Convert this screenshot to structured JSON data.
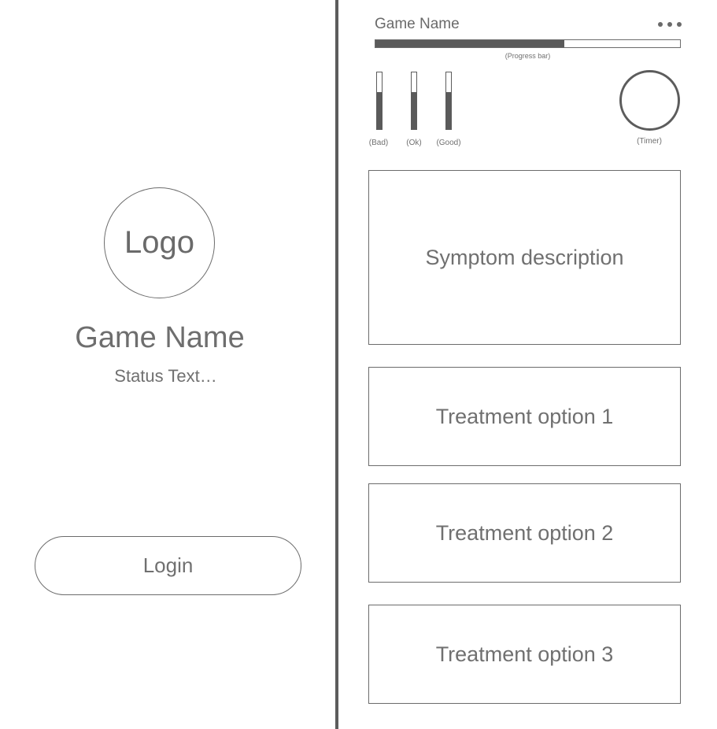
{
  "login_screen": {
    "logo_text": "Logo",
    "game_name": "Game Name",
    "status_text": "Status Text…",
    "login_label": "Login"
  },
  "game_screen": {
    "game_name": "Game Name",
    "menu_icon": "more-horizontal-icon",
    "progress": {
      "label": "(Progress bar)",
      "fraction": 0.62
    },
    "meters": [
      {
        "label": "(Bad)",
        "fraction": 0.65
      },
      {
        "label": "(Ok)",
        "fraction": 0.65
      },
      {
        "label": "(Good)",
        "fraction": 0.65
      }
    ],
    "timer_label": "(Timer)",
    "symptom_text": "Symptom description",
    "treatments": [
      {
        "label": "Treatment option 1"
      },
      {
        "label": "Treatment option 2"
      },
      {
        "label": "Treatment option 3"
      }
    ]
  }
}
